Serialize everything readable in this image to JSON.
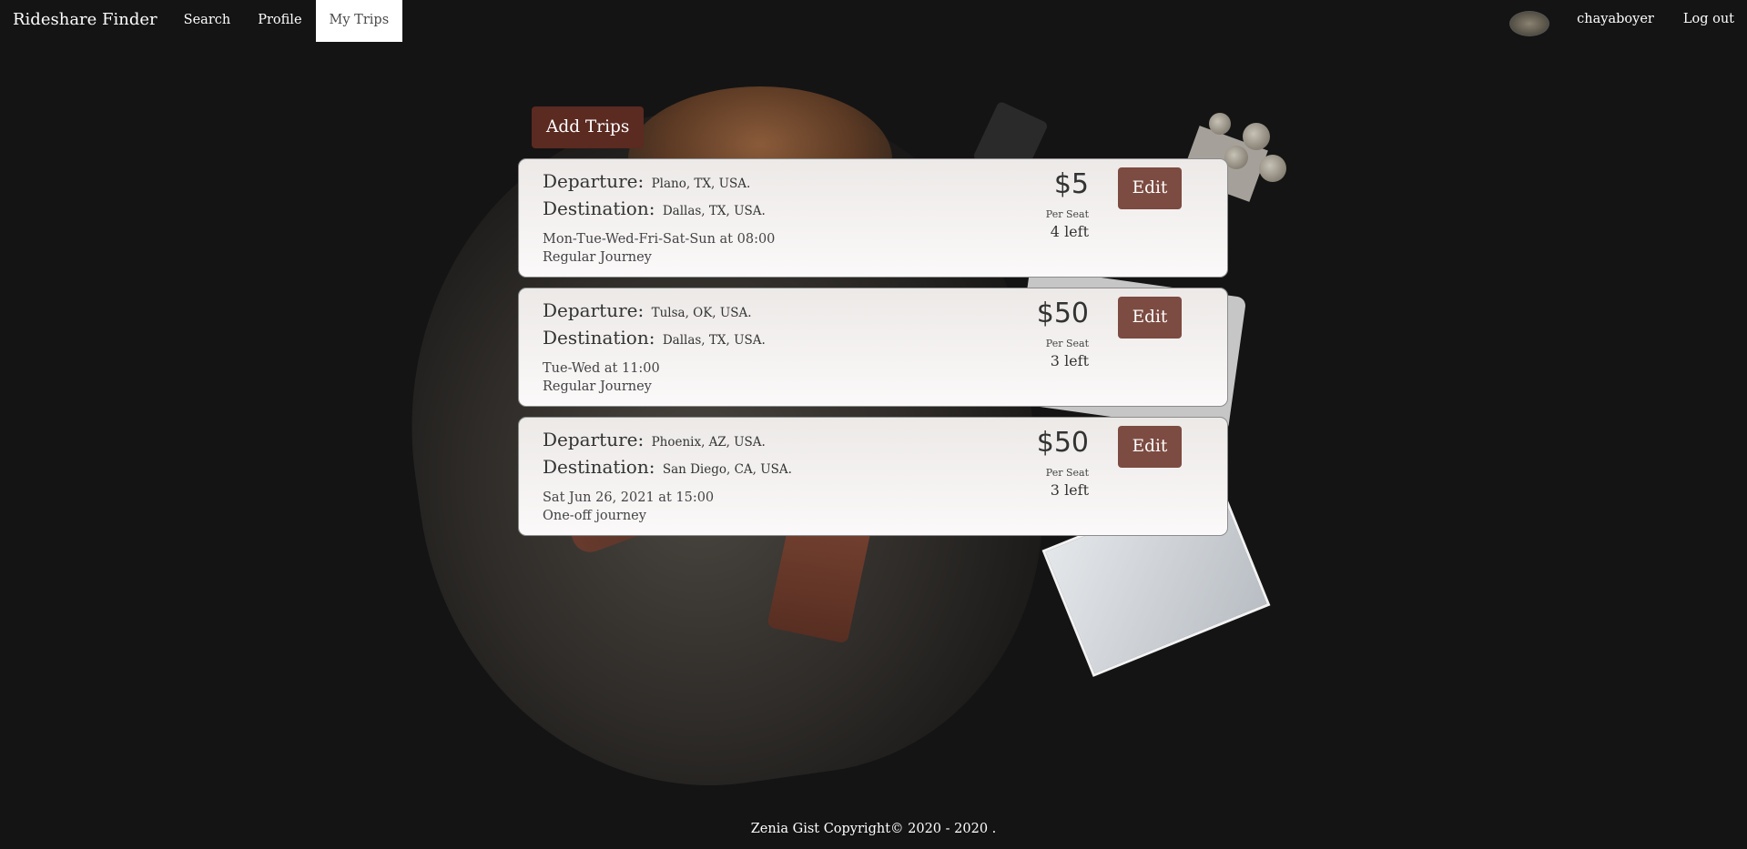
{
  "nav": {
    "brand": "Rideshare Finder",
    "items": [
      {
        "label": "Search"
      },
      {
        "label": "Profile"
      },
      {
        "label": "My Trips",
        "active": true
      }
    ],
    "username": "chayaboyer",
    "logout": "Log out"
  },
  "add_trips_label": "Add Trips",
  "trips": [
    {
      "departure_label": "Departure:",
      "departure": "Plano, TX, USA.",
      "destination_label": "Destination:",
      "destination": "Dallas, TX, USA.",
      "schedule": "Mon-Tue-Wed-Fri-Sat-Sun at 08:00",
      "journey_type": "Regular Journey",
      "price": "$5",
      "per_seat": "Per Seat",
      "seats_left": "4 left",
      "edit_label": "Edit"
    },
    {
      "departure_label": "Departure:",
      "departure": "Tulsa, OK, USA.",
      "destination_label": "Destination:",
      "destination": "Dallas, TX, USA.",
      "schedule": "Tue-Wed at 11:00",
      "journey_type": "Regular Journey",
      "price": "$50",
      "per_seat": "Per Seat",
      "seats_left": "3 left",
      "edit_label": "Edit"
    },
    {
      "departure_label": "Departure:",
      "departure": "Phoenix, AZ, USA.",
      "destination_label": "Destination:",
      "destination": "San Diego, CA, USA.",
      "schedule": "Sat Jun 26, 2021 at 15:00",
      "journey_type": "One-off journey",
      "price": "$50",
      "per_seat": "Per Seat",
      "seats_left": "3 left",
      "edit_label": "Edit"
    }
  ],
  "footer": "Zenia Gist Copyright© 2020 - 2020 .",
  "colors": {
    "background": "#141414",
    "add_button": "#5b2a21",
    "edit_button": "#7c4b41",
    "card": "#f4f1f0"
  }
}
